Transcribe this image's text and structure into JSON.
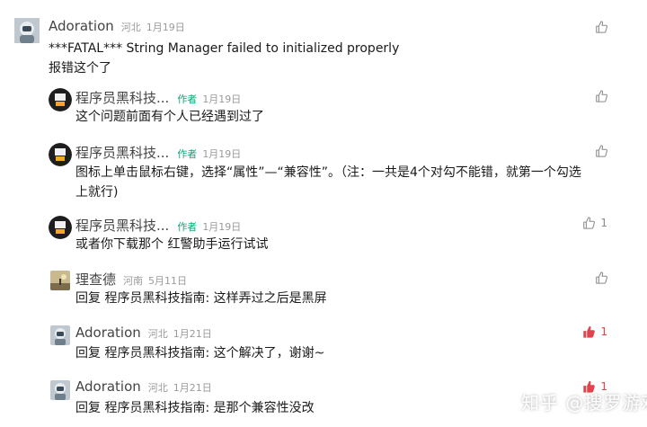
{
  "colors": {
    "author_tag": "#06a777",
    "liked": "#e0434d",
    "meta": "#9a9a9a"
  },
  "comments": [
    {
      "author": "Adoration",
      "location": "河北",
      "date": "1月19日",
      "lines": [
        "***FATAL*** String Manager failed to initialized properly",
        "报错这个了"
      ],
      "likes": ""
    },
    {
      "author": "程序员黑科技...",
      "tag": "作者",
      "date": "1月19日",
      "lines": [
        "这个问题前面有个人已经遇到过了"
      ],
      "likes": ""
    },
    {
      "author": "程序员黑科技...",
      "tag": "作者",
      "date": "1月19日",
      "lines": [
        "图标上单击鼠标右键，选择“属性”—“兼容性”。（注：一共是4个对勾不能错，就第一个勾选",
        "上就行)"
      ],
      "likes": ""
    },
    {
      "author": "程序员黑科技...",
      "tag": "作者",
      "date": "1月19日",
      "lines": [
        "或者你下载那个 红警助手运行试试"
      ],
      "likes": "1"
    },
    {
      "author": "理查德",
      "location": "河南",
      "date": "5月11日",
      "reply_prefix": "回复 ",
      "reply_to": "程序员黑科技指南",
      "reply_text": ": 这样弄过之后是黑屏",
      "likes": ""
    },
    {
      "author": "Adoration",
      "location": "河北",
      "date": "1月21日",
      "reply_prefix": "回复 ",
      "reply_to": "程序员黑科技指南",
      "reply_text": ": 这个解决了，谢谢~",
      "likes": "1"
    },
    {
      "author": "Adoration",
      "location": "河北",
      "date": "1月21日",
      "reply_prefix": "回复 ",
      "reply_to": "程序员黑科技指南",
      "reply_text": ": 是那个兼容性没改",
      "likes": "1"
    }
  ],
  "watermark": "知乎 @搜罗游戏",
  "icons": {
    "like": "thumbs-up-icon"
  }
}
